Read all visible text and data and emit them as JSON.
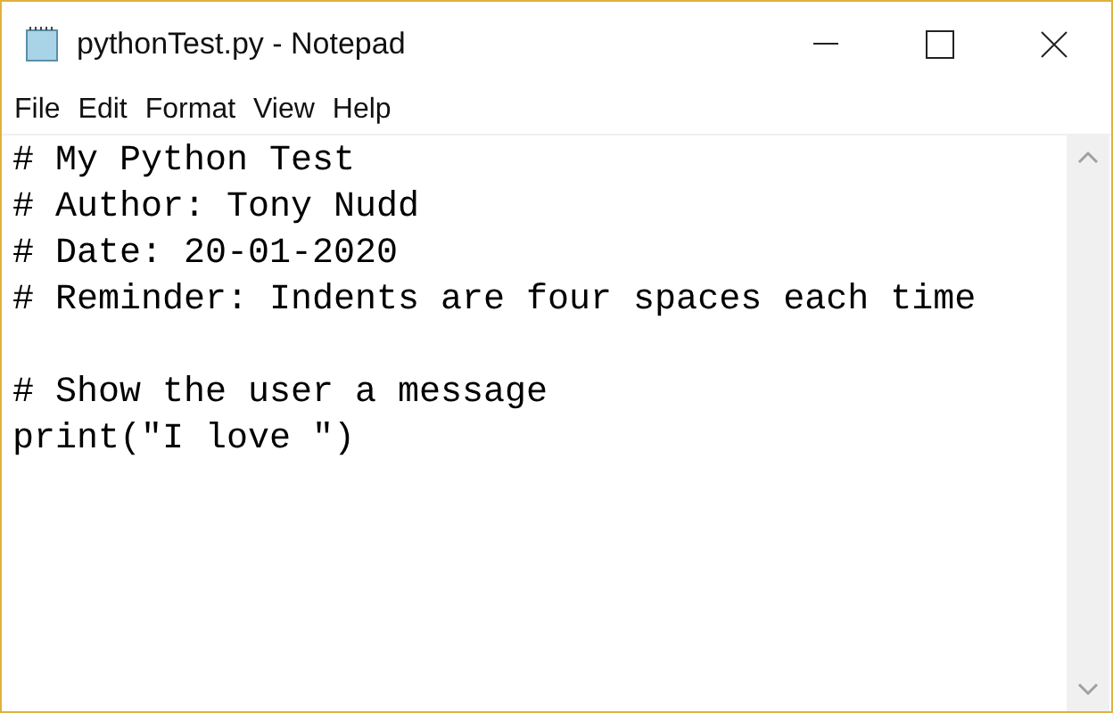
{
  "window": {
    "title": "pythonTest.py - Notepad"
  },
  "menu": [
    "File",
    "Edit",
    "Format",
    "View",
    "Help"
  ],
  "editor": {
    "lines": [
      {
        "kind": "text",
        "text": "# My Python Test"
      },
      {
        "kind": "text",
        "text": "# Author: Tony Nudd"
      },
      {
        "kind": "text",
        "text": "# Date: 20-01-2020"
      },
      {
        "kind": "text",
        "text": "# Reminder: Indents are four spaces each time"
      },
      {
        "kind": "blank"
      },
      {
        "kind": "text",
        "text": "# Show the user a message"
      },
      {
        "kind": "text",
        "text": "print(\"I love \")"
      }
    ]
  }
}
